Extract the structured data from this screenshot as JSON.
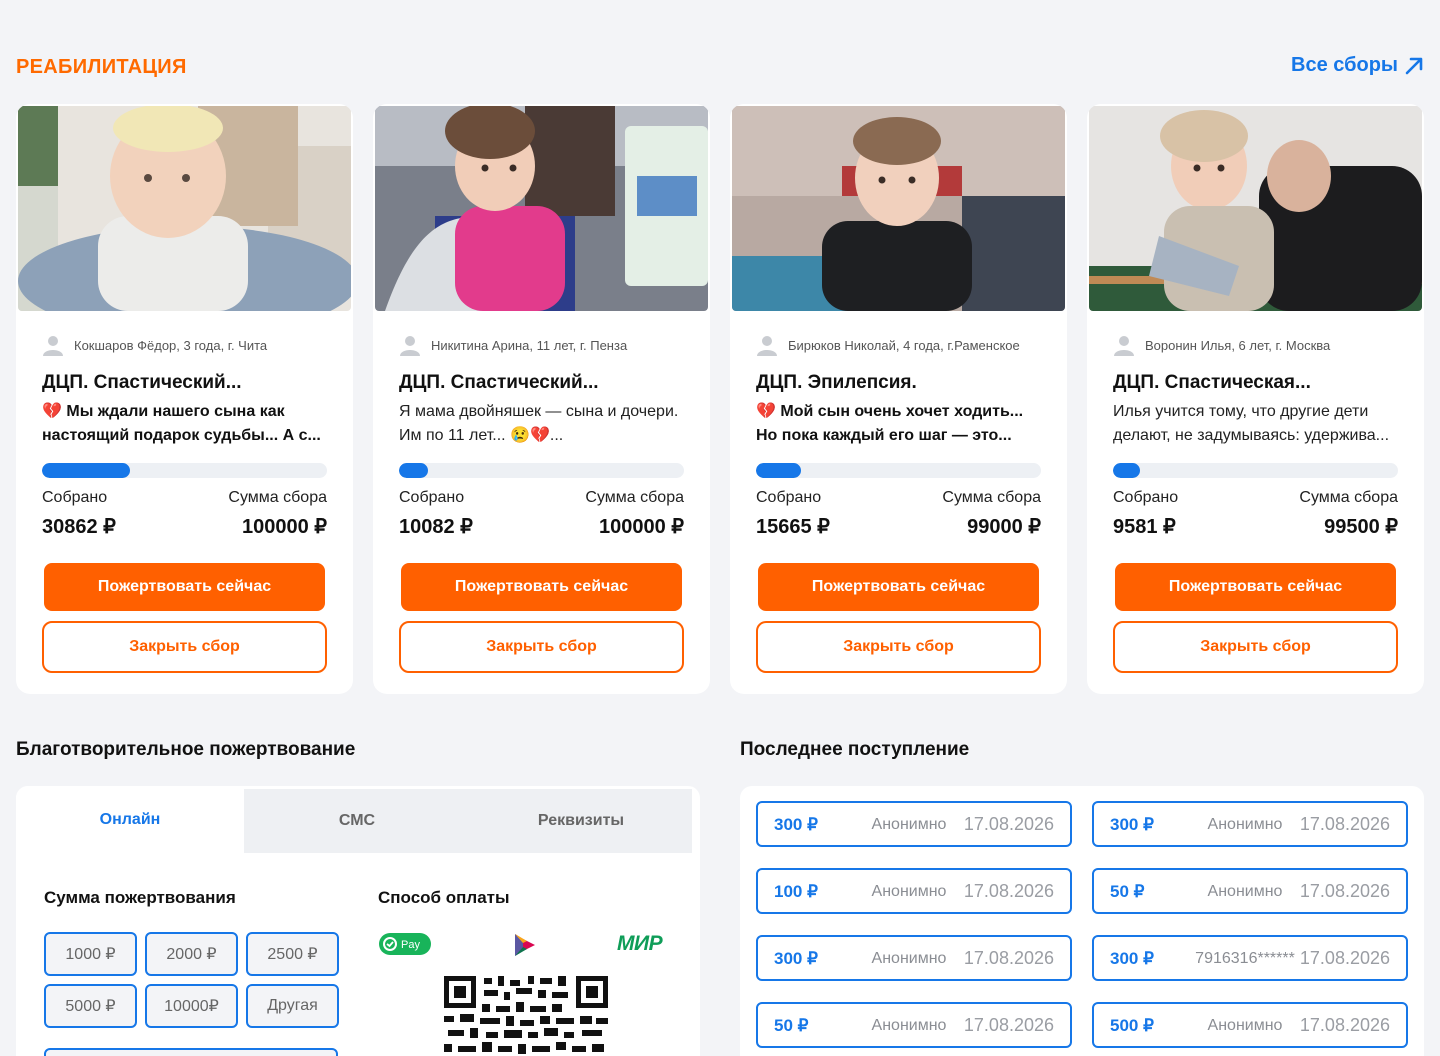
{
  "section": {
    "title": "РЕАБИЛИТАЦИЯ",
    "all_link": "Все сборы"
  },
  "colors": {
    "accent_orange": "#ff6000",
    "accent_blue": "#1677e8",
    "background": "#f3f4f7"
  },
  "cards": [
    {
      "author": "Кокшаров Фёдор, 3 года, г. Чита",
      "title": "ДЦП. Спастический...",
      "desc_line1": "💔 Мы ждали нашего сына как",
      "desc_line2": "настоящий подарок судьбы... А с...",
      "desc_bold": true,
      "progress_fraction": 0.309,
      "collected_label": "Собрано",
      "collected": "30862 ₽",
      "goal_label": "Сумма сбора",
      "goal": "100000 ₽",
      "donate_label": "Пожертвовать сейчас",
      "close_label": "Закрыть сбор"
    },
    {
      "author": "Никитина Арина, 11 лет, г. Пенза",
      "title": "ДЦП. Спастический...",
      "desc_line1": "Я мама двойняшек — сына и дочери.",
      "desc_line2": "Им по 11 лет... 😢💔...",
      "desc_bold": false,
      "progress_fraction": 0.101,
      "collected_label": "Собрано",
      "collected": "10082 ₽",
      "goal_label": "Сумма сбора",
      "goal": "100000 ₽",
      "donate_label": "Пожертвовать сейчас",
      "close_label": "Закрыть сбор"
    },
    {
      "author": "Бирюков Николай, 4 года, г.Раменское",
      "title": "ДЦП. Эпилепсия.",
      "desc_line1": "💔 Мой сын очень хочет ходить...",
      "desc_line2": "Но пока каждый его шаг — это...",
      "desc_bold": true,
      "progress_fraction": 0.158,
      "collected_label": "Собрано",
      "collected": "15665 ₽",
      "goal_label": "Сумма сбора",
      "goal": "99000 ₽",
      "donate_label": "Пожертвовать сейчас",
      "close_label": "Закрыть сбор"
    },
    {
      "author": "Воронин Илья, 6 лет, г. Москва",
      "title": "ДЦП. Спастическая...",
      "desc_line1": "Илья учится тому, что другие дети",
      "desc_line2": "делают, не задумываясь: удержива...",
      "desc_bold": false,
      "progress_fraction": 0.096,
      "collected_label": "Собрано",
      "collected": "9581 ₽",
      "goal_label": "Сумма сбора",
      "goal": "99500 ₽",
      "donate_label": "Пожертвовать сейчас",
      "close_label": "Закрыть сбор"
    }
  ],
  "donation": {
    "heading": "Благотворительное пожертвование",
    "tabs": [
      "Онлайн",
      "СМС",
      "Реквизиты"
    ],
    "active_tab": "Онлайн",
    "amount_heading": "Сумма пожертвования",
    "amounts": [
      "1000 ₽",
      "2000 ₽",
      "2500 ₽",
      "5000 ₽",
      "10000₽",
      "Другая"
    ],
    "payment_heading": "Способ оплаты",
    "payment_methods": [
      "Pay",
      "МИР"
    ]
  },
  "feed": {
    "heading": "Последнее поступление",
    "rows": [
      {
        "amount": "300 ₽",
        "donor": "Анонимно",
        "date": "17.08.2026"
      },
      {
        "amount": "300 ₽",
        "donor": "Анонимно",
        "date": "17.08.2026"
      },
      {
        "amount": "100 ₽",
        "donor": "Анонимно",
        "date": "17.08.2026"
      },
      {
        "amount": "50 ₽",
        "donor": "Анонимно",
        "date": "17.08.2026"
      },
      {
        "amount": "300 ₽",
        "donor": "Анонимно",
        "date": "17.08.2026"
      },
      {
        "amount": "300 ₽",
        "donor": "7916316******",
        "date": "17.08.2026"
      },
      {
        "amount": "50 ₽",
        "donor": "Анонимно",
        "date": "17.08.2026"
      },
      {
        "amount": "500 ₽",
        "donor": "Анонимно",
        "date": "17.08.2026"
      }
    ]
  }
}
